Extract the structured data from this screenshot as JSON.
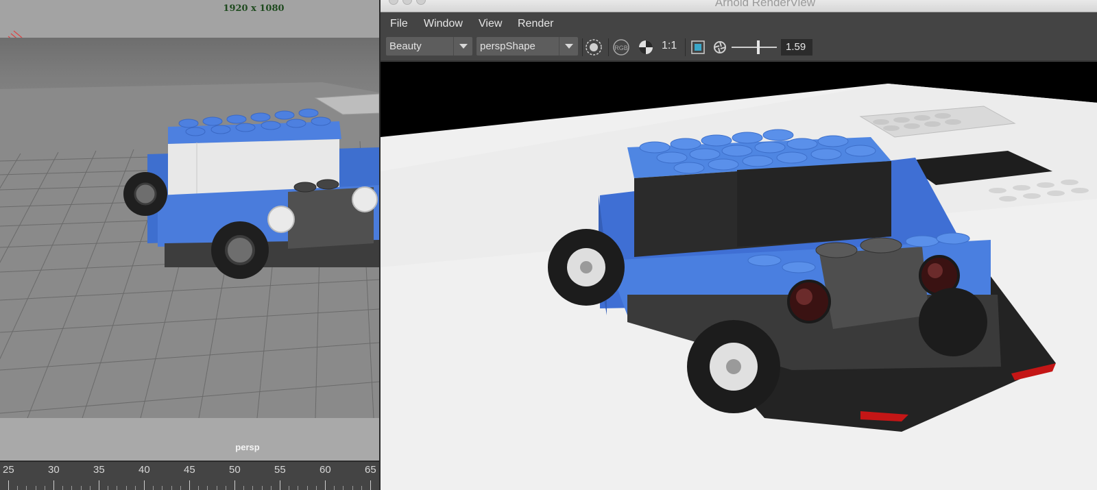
{
  "viewport": {
    "resolution_gate_label": "1920 x 1080",
    "camera_label": "persp",
    "timeline_ticks": [
      "25",
      "30",
      "35",
      "40",
      "45",
      "50",
      "55",
      "60",
      "65"
    ]
  },
  "render_view": {
    "title": "Arnold RenderView",
    "menu": {
      "file": "File",
      "window": "Window",
      "view": "View",
      "render": "Render"
    },
    "toolbar": {
      "aov_selected": "Beauty",
      "camera_selected": "perspShape",
      "rgb_label": "RGB",
      "zoom_ratio": "1:1",
      "exposure_value": "1.59",
      "exposure_level": 0.6
    }
  },
  "icons": {
    "region_render": "target-circle-icon",
    "rgb_channels": "rgb-channels-icon",
    "ab_compare": "ab-compare-icon",
    "crop_region": "crop-region-icon",
    "exposure": "aperture-icon"
  },
  "colors": {
    "lego_blue": "#4f86e2",
    "tyre": "#1c1c1c",
    "window_bg": "#444444"
  }
}
